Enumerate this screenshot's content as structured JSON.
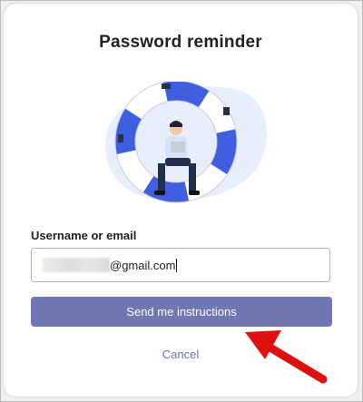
{
  "dialog": {
    "title": "Password reminder",
    "illustration": "lifebuoy-person-laptop-illustration"
  },
  "form": {
    "label": "Username or email",
    "email_value": "@gmail.com",
    "send_label": "Send me instructions",
    "cancel_label": "Cancel"
  },
  "annotation": {
    "arrow": "red-arrow-icon"
  },
  "colors": {
    "primary_button": "#7077b2",
    "link": "#6a72b8",
    "lifebuoy_blue": "#3f5fe0",
    "arrow_red": "#e01010"
  }
}
